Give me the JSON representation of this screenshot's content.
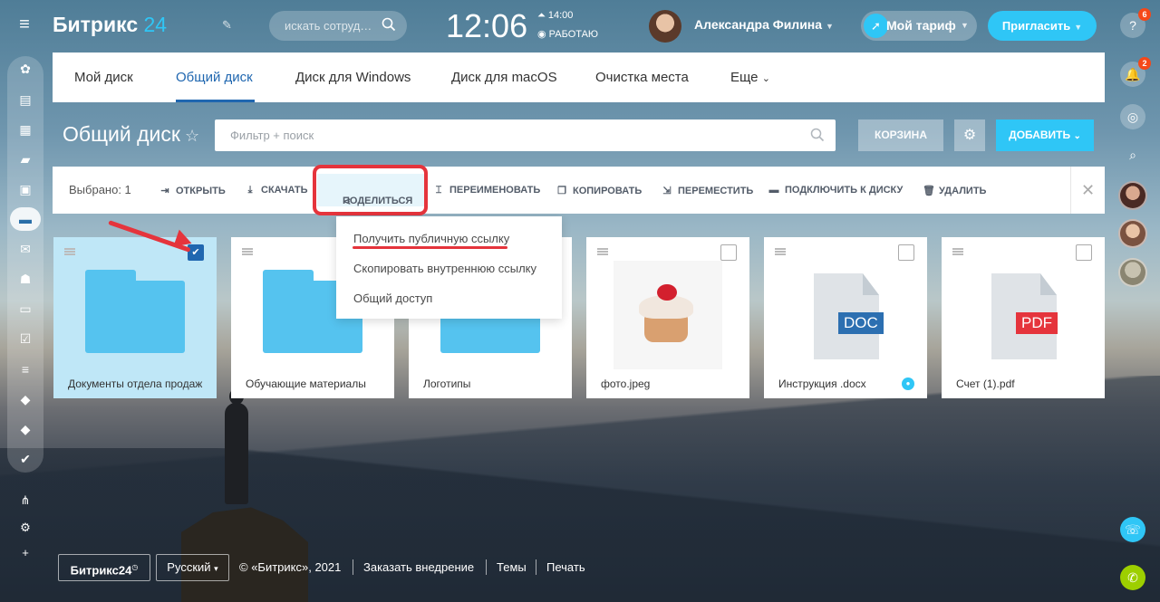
{
  "topbar": {
    "brand": "Битрикс",
    "brand_num": "24",
    "search_placeholder": "искать сотруд…",
    "time": "12:06",
    "alarm": "14:00",
    "work_status": "РАБОТАЮ",
    "user_name": "Александра Филина",
    "tariff": "Мой тариф",
    "invite": "Пригласить"
  },
  "tabs": [
    "Мой диск",
    "Общий диск",
    "Диск для Windows",
    "Диск для macOS",
    "Очистка места",
    "Еще"
  ],
  "page": {
    "title": "Общий диск",
    "filter_placeholder": "Фильтр + поиск",
    "trash": "КОРЗИНА",
    "add": "ДОБАВИТЬ"
  },
  "toolbar": {
    "selected": "Выбрано: 1",
    "open": "ОТКРЫТЬ",
    "download": "СКАЧАТЬ",
    "share": "ПОДЕЛИТЬСЯ",
    "rename": "ПЕРЕИМЕНОВАТЬ",
    "copy": "КОПИРОВАТЬ",
    "move": "ПЕРЕМЕСТИТЬ",
    "connect": "ПОДКЛЮЧИТЬ К ДИСКУ",
    "delete": "УДАЛИТЬ"
  },
  "share_menu": [
    "Получить публичную ссылку",
    "Скопировать внутреннюю ссылку",
    "Общий доступ"
  ],
  "files": [
    {
      "name": "Документы отдела продаж",
      "kind": "folder",
      "selected": true
    },
    {
      "name": "Обучающие материалы",
      "kind": "folder",
      "selected": false
    },
    {
      "name": "Логотипы",
      "kind": "folder",
      "selected": false
    },
    {
      "name": "фото.jpeg",
      "kind": "image",
      "selected": false
    },
    {
      "name": "Инструкция .docx",
      "kind": "doc",
      "ext": "DOC",
      "selected": false
    },
    {
      "name": "Счет (1).pdf",
      "kind": "pdf",
      "ext": "PDF",
      "selected": false
    }
  ],
  "right_rail": {
    "help_badge": "6",
    "notif_badge": "2"
  },
  "footer": {
    "logo": "Битрикс24",
    "lang": "Русский",
    "copyright": "© «Битрикс», 2021",
    "order": "Заказать внедрение",
    "themes": "Темы",
    "print": "Печать"
  },
  "colors": {
    "accent": "#2fc6f6",
    "link": "#2067b0",
    "highlight": "#e5343c",
    "doc": "#2c6fb1",
    "pdf": "#e5343c"
  }
}
